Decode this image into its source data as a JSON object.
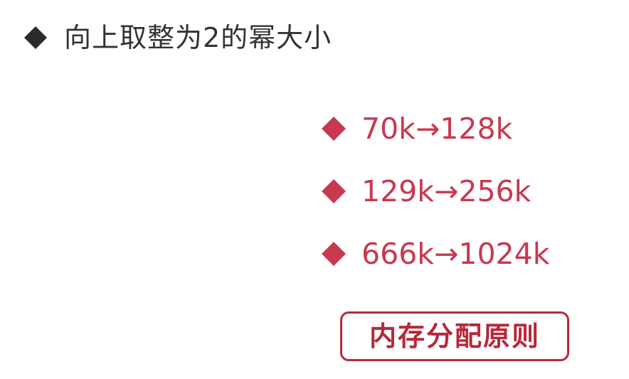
{
  "heading": {
    "bullet_icon": "diamond-bullet-icon",
    "bullet_color": "#2b2b2b",
    "text": "向上取整为2的幂大小"
  },
  "examples": {
    "bullet_icon": "diamond-bullet-icon",
    "color": "#c7394f",
    "items": [
      {
        "text": "70k→128k"
      },
      {
        "text": "129k→256k"
      },
      {
        "text": "666k→1024k"
      }
    ]
  },
  "principle_button": {
    "label": "内存分配原则",
    "color": "#b7283a"
  }
}
